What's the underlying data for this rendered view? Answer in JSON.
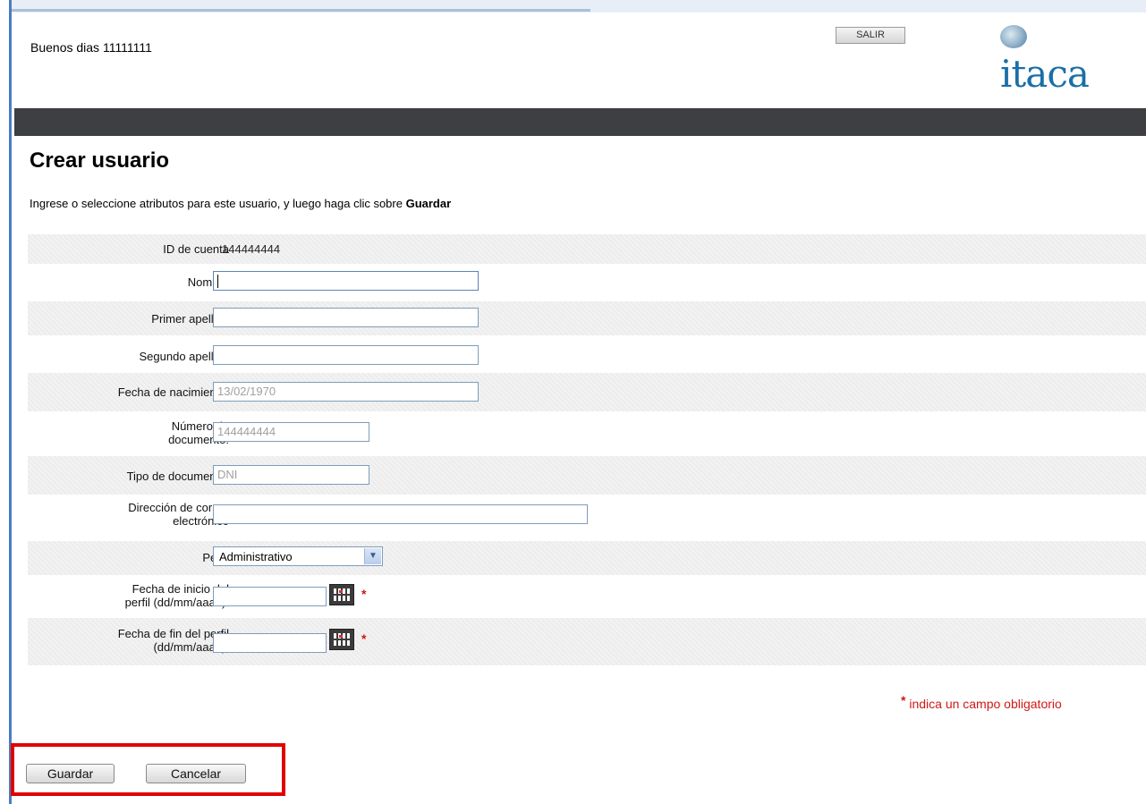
{
  "header": {
    "greeting": "Buenos dias 11111111",
    "logout_label": "SALIR",
    "logo_text": "itaca"
  },
  "page": {
    "title": "Crear usuario",
    "instructions_prefix": "Ingrese o seleccione atributos para este usuario, y luego haga clic sobre ",
    "instructions_bold": "Guardar"
  },
  "form": {
    "account_id": {
      "label": "ID de cuenta",
      "value": "144444444"
    },
    "nombre": {
      "label": "Nombre",
      "value": ""
    },
    "primer_apellido": {
      "label": "Primer apellido",
      "value": ""
    },
    "segundo_apellido": {
      "label": "Segundo apellido",
      "value": ""
    },
    "fecha_nacimiento": {
      "label": "Fecha de nacimiento:",
      "value": "13/02/1970"
    },
    "numero_documento": {
      "label_line1": "Número de",
      "label_line2": "documento:",
      "value": "144444444"
    },
    "tipo_documento": {
      "label": "Tipo de documento:",
      "value": "DNI"
    },
    "correo": {
      "label_line1": "Dirección de correo",
      "label_line2": "electrónico",
      "value": ""
    },
    "perfil": {
      "label": "Perfil",
      "selected": "Administrativo"
    },
    "fecha_inicio": {
      "label_line1": "Fecha de inicio del",
      "label_line2": "perfil (dd/mm/aaaa):",
      "value": ""
    },
    "fecha_fin": {
      "label_line1": "Fecha de fin del perfil",
      "label_line2": "(dd/mm/aaaa):",
      "value": ""
    },
    "required_marker": "*",
    "required_note": "indica un campo obligatorio"
  },
  "actions": {
    "save_label": "Guardar",
    "cancel_label": "Cancelar"
  },
  "colors": {
    "header_bar": "#3d3f42",
    "required": "#d01818",
    "highlight_box": "#e00000",
    "logo": "#1a6fa8"
  },
  "icons": {
    "calendar": "calendar-icon",
    "dropdown": "chevron-down-icon"
  }
}
